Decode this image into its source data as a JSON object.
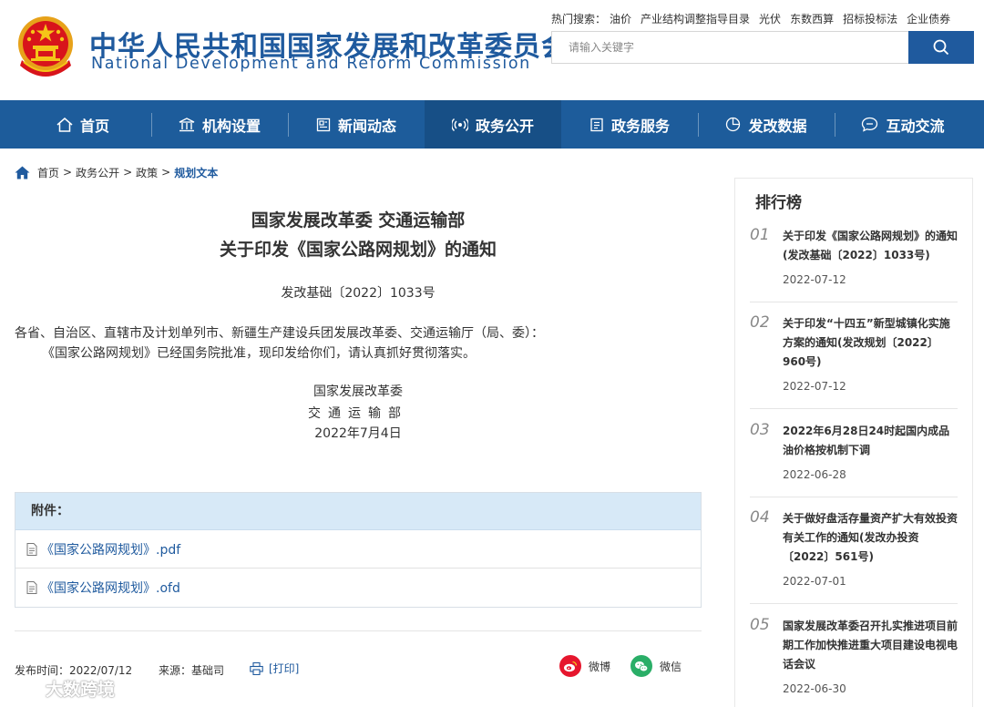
{
  "header": {
    "title_cn": "中华人民共和国国家发展和改革委员会",
    "title_en": "National Development and Reform Commission",
    "hot_label": "热门搜索：",
    "hot_terms": [
      "油价",
      "产业结构调整指导目录",
      "光伏",
      "东数西算",
      "招标投标法",
      "企业债券"
    ],
    "search_placeholder": "请输入关键字",
    "search_icon": "search-icon"
  },
  "nav": {
    "items": [
      {
        "label": "首页",
        "icon": "home-icon"
      },
      {
        "label": "机构设置",
        "icon": "building-icon"
      },
      {
        "label": "新闻动态",
        "icon": "newspaper-icon"
      },
      {
        "label": "政务公开",
        "icon": "broadcast-icon"
      },
      {
        "label": "政务服务",
        "icon": "document-icon"
      },
      {
        "label": "发改数据",
        "icon": "pie-chart-icon"
      },
      {
        "label": "互动交流",
        "icon": "chat-icon"
      }
    ],
    "active_index": 3,
    "bar_color": "#1d5c9b",
    "active_color": "#174f86"
  },
  "breadcrumb": {
    "items": [
      "首页",
      "政务公开",
      "政策"
    ],
    "current": "规划文本",
    "separator": ">"
  },
  "article": {
    "title_line1": "国家发展改革委 交通运输部",
    "title_line2": "关于印发《国家公路网规划》的通知",
    "doc_number": "发改基础〔2022〕1033号",
    "para1": "各省、自治区、直辖市及计划单列市、新疆生产建设兵团发展改革委、交通运输厅（局、委）：",
    "para2": "《国家公路网规划》已经国务院批准，现印发给你们，请认真抓好贯彻落实。",
    "signer1": "国家发展改革委",
    "signer2": "交通运输部",
    "sign_date": "2022年7月4日",
    "attach_label": "附件：",
    "attachments": [
      "《国家公路网规划》.pdf",
      "《国家公路网规划》.ofd"
    ],
    "publish_label": "发布时间：",
    "publish_date": "2022/07/12",
    "source_label": "来源：",
    "source": "基础司",
    "print_label": "[打印]",
    "share_weibo": "微博",
    "share_wechat": "微信"
  },
  "sidebar": {
    "title": "排行榜",
    "items": [
      {
        "num": "01",
        "text": "关于印发《国家公路网规划》的通知(发改基础〔2022〕1033号)",
        "date": "2022-07-12"
      },
      {
        "num": "02",
        "text": "关于印发“十四五”新型城镇化实施方案的通知(发改规划〔2022〕960号)",
        "date": "2022-07-12"
      },
      {
        "num": "03",
        "text": "2022年6月28日24时起国内成品油价格按机制下调",
        "date": "2022-06-28"
      },
      {
        "num": "04",
        "text": "关于做好盘活存量资产扩大有效投资有关工作的通知(发改办投资〔2022〕561号)",
        "date": "2022-07-01"
      },
      {
        "num": "05",
        "text": "国家发展改革委召开扎实推进项目前期工作加快推进重大项目建设电视电话会议",
        "date": "2022-06-30"
      }
    ]
  },
  "watermark": {
    "text": "大数跨境"
  },
  "colors": {
    "brand_blue": "#1f5a9e",
    "emblem_red": "#d8141b",
    "emblem_gold": "#f5c518",
    "attach_header": "#d7e9f7",
    "weibo_red": "#e6162d",
    "wechat_green": "#2aae67"
  }
}
